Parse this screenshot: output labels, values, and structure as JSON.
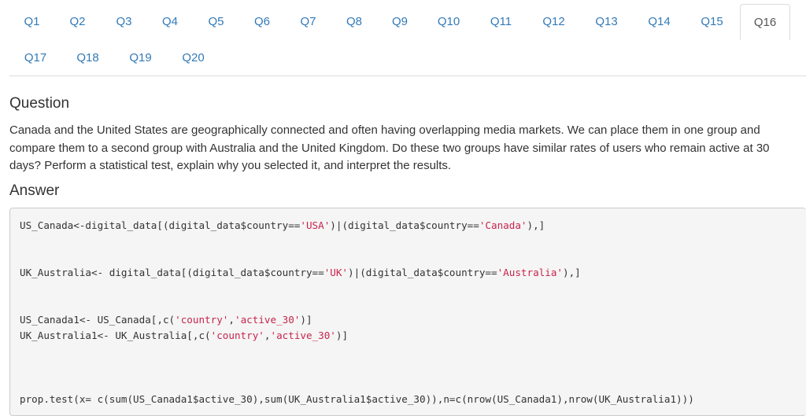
{
  "tabs": [
    {
      "label": "Q1",
      "active": false
    },
    {
      "label": "Q2",
      "active": false
    },
    {
      "label": "Q3",
      "active": false
    },
    {
      "label": "Q4",
      "active": false
    },
    {
      "label": "Q5",
      "active": false
    },
    {
      "label": "Q6",
      "active": false
    },
    {
      "label": "Q7",
      "active": false
    },
    {
      "label": "Q8",
      "active": false
    },
    {
      "label": "Q9",
      "active": false
    },
    {
      "label": "Q10",
      "active": false
    },
    {
      "label": "Q11",
      "active": false
    },
    {
      "label": "Q12",
      "active": false
    },
    {
      "label": "Q13",
      "active": false
    },
    {
      "label": "Q14",
      "active": false
    },
    {
      "label": "Q15",
      "active": false
    },
    {
      "label": "Q16",
      "active": true
    },
    {
      "label": "Q17",
      "active": false
    },
    {
      "label": "Q18",
      "active": false
    },
    {
      "label": "Q19",
      "active": false
    },
    {
      "label": "Q20",
      "active": false
    }
  ],
  "question": {
    "heading": "Question",
    "text": "Canada and the United States are geographically connected and often having overlapping media markets. We can place them in one group and compare them to a second group with Australia and the United Kingdom. Do these two groups have similar rates of users who remain active at 30 days? Perform a statistical test, explain why you selected it, and interpret the results."
  },
  "answer": {
    "heading": "Answer",
    "code": {
      "line1": {
        "p1": "US_Canada<-digital_data[(digital_data$country==",
        "s1": "'USA'",
        "p2": ")|(digital_data$country==",
        "s2": "'Canada'",
        "p3": "),]"
      },
      "line2": {
        "p1": "UK_Australia<- digital_data[(digital_data$country==",
        "s1": "'UK'",
        "p2": ")|(digital_data$country==",
        "s2": "'Australia'",
        "p3": "),]"
      },
      "line3": {
        "p1": "US_Canada1<- US_Canada[,c(",
        "s1": "'country'",
        "p2": ",",
        "s2": "'active_30'",
        "p3": ")]"
      },
      "line4": {
        "p1": "UK_Australia1<- UK_Australia[,c(",
        "s1": "'country'",
        "p2": ",",
        "s2": "'active_30'",
        "p3": ")]"
      },
      "line5": {
        "p1": "prop.test(x= c(sum(US_Canada1$active_30),sum(UK_Australia1$active_30)),n=c(nrow(US_Canada1),nrow(UK_Australia1)))"
      }
    }
  }
}
